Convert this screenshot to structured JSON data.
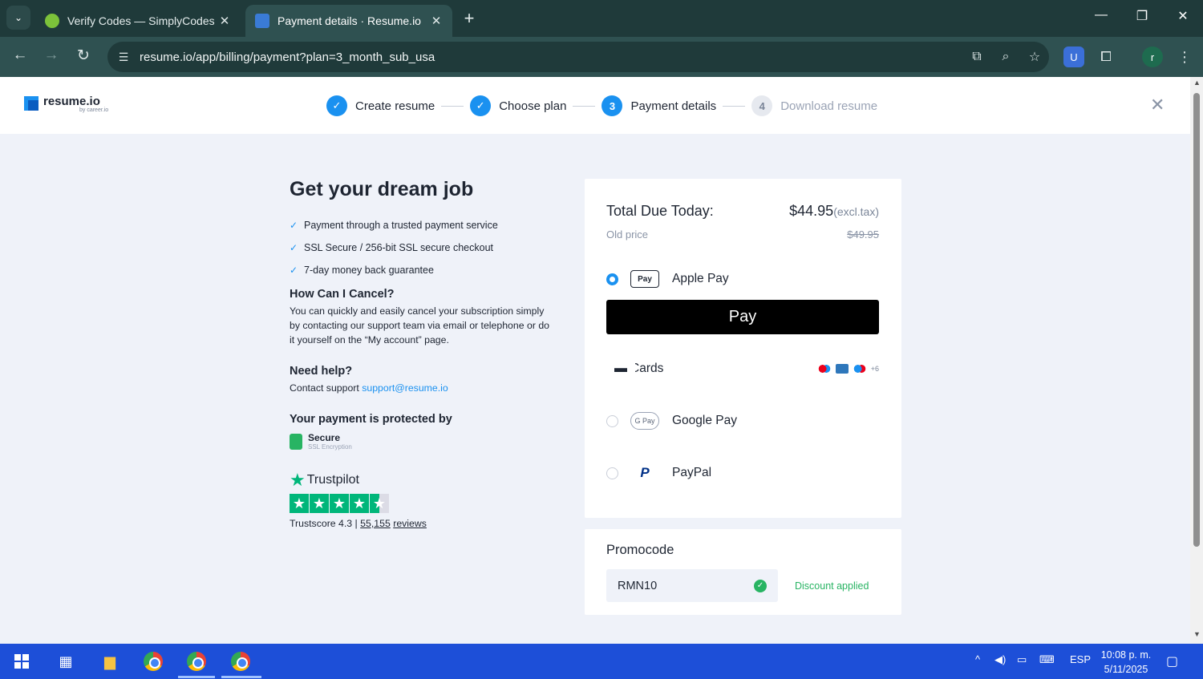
{
  "browser": {
    "tabs": [
      {
        "title": "Verify Codes — SimplyCodes",
        "active": false
      },
      {
        "title": "Payment details · Resume.io",
        "active": true
      }
    ],
    "url": "resume.io/app/billing/payment?plan=3_month_sub_usa",
    "profile_initial": "r",
    "window_controls": {
      "minimize": "—",
      "restore": "❐",
      "close": "✕"
    }
  },
  "header": {
    "logo_text": "resume.io",
    "logo_sub": "by career.io",
    "steps": [
      {
        "index": "✓",
        "label": "Create resume",
        "state": "done"
      },
      {
        "index": "✓",
        "label": "Choose plan",
        "state": "done"
      },
      {
        "index": "3",
        "label": "Payment details",
        "state": "current"
      },
      {
        "index": "4",
        "label": "Download resume",
        "state": "todo"
      }
    ]
  },
  "left": {
    "title": "Get your dream job",
    "benefits": [
      "Payment through a trusted payment service",
      "SSL Secure / 256-bit SSL secure checkout",
      "7-day money back guarantee"
    ],
    "cancel_title": "How Can I Cancel?",
    "cancel_text": "You can quickly and easily cancel your subscription simply by contacting our support team via email or telephone or do it yourself on the “My account” page.",
    "help_title": "Need help?",
    "help_prefix": "Contact support",
    "help_email": "support@resume.io",
    "protected_title": "Your payment is protected by",
    "secure_title": "Secure",
    "secure_sub": "SSL Encryption",
    "trustpilot_name": "Trustpilot",
    "trustscore_label": "Trustscore 4.3 |",
    "review_count": "55,155",
    "reviews_label": "reviews",
    "rating": 4.3
  },
  "payment": {
    "total_label": "Total Due Today:",
    "total_price": "$44.95",
    "excl_tax": "(excl.tax)",
    "old_label": "Old price",
    "old_price": "$49.95",
    "methods": {
      "apple": {
        "label": "Apple Pay",
        "icon": "Pay",
        "selected": true
      },
      "cards": {
        "label": "Cards",
        "more": "+6"
      },
      "google": {
        "label": "Google Pay",
        "icon": "G Pay"
      },
      "paypal": {
        "label": "PayPal",
        "icon": "P"
      }
    },
    "applepay_button": "Pay"
  },
  "promo": {
    "title": "Promocode",
    "value": "RMN10",
    "status": "Discount applied"
  },
  "taskbar": {
    "lang": "ESP",
    "time": "10:08 p. m.",
    "date": "5/11/2025"
  }
}
